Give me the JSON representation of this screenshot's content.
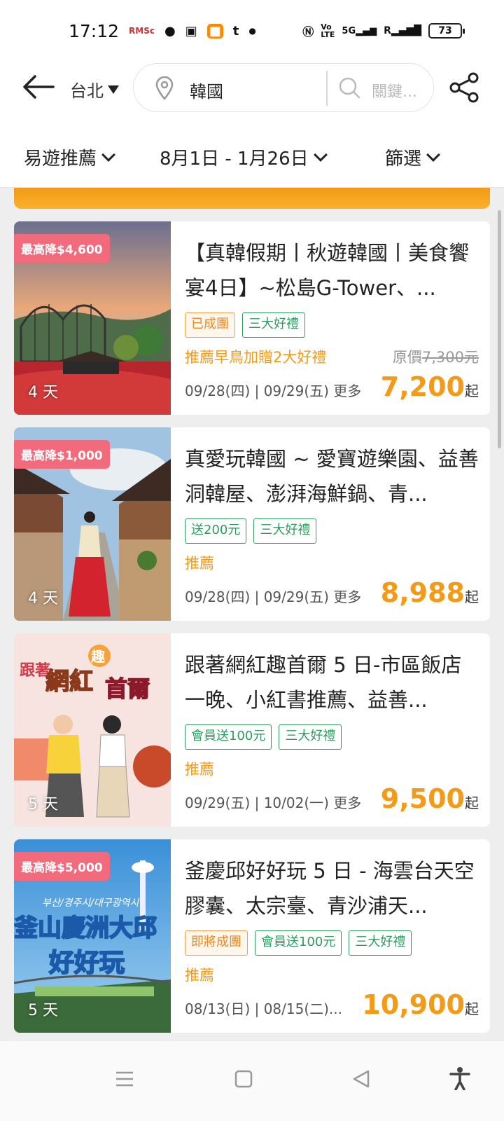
{
  "status": {
    "time": "17:12",
    "battery": "73",
    "notif_labels": [
      "RMSc",
      "t"
    ]
  },
  "header": {
    "city": "台北",
    "destination": "韓國",
    "keyword_placeholder": "關鍵..."
  },
  "filters": {
    "sort": "易遊推薦",
    "dates": "8月1日 - 1月26日",
    "filter": "篩選"
  },
  "cards": [
    {
      "discount": "最高降$4,600",
      "days": "4 天",
      "title": "【真韓假期丨秋遊韓國丨美食饗宴4日】~松島G-Tower、...",
      "tags": [
        {
          "label": "已成團",
          "style": "orange"
        },
        {
          "label": "三大好禮",
          "style": "green"
        }
      ],
      "promo": "推薦早鳥加贈2大好禮",
      "orig_label": "原價",
      "orig_price": "7,300元",
      "dates": "09/28(四) | 09/29(五) 更多",
      "price": "7,200",
      "suffix": "起"
    },
    {
      "discount": "最高降$1,000",
      "days": "4 天",
      "title": "真愛玩韓國 ~ 愛寶遊樂園、益善洞韓屋、澎湃海鮮鍋、青...",
      "tags": [
        {
          "label": "送200元",
          "style": "green"
        },
        {
          "label": "三大好禮",
          "style": "green"
        }
      ],
      "promo": "推薦",
      "orig_label": "",
      "orig_price": "",
      "dates": "09/28(四) | 09/29(五) 更多",
      "price": "8,988",
      "suffix": "起"
    },
    {
      "discount": "",
      "days": "5 天",
      "title": "跟著網紅趣首爾 5 日-市區飯店一晚、小紅書推薦、益善...",
      "tags": [
        {
          "label": "會員送100元",
          "style": "green"
        },
        {
          "label": "三大好禮",
          "style": "green"
        }
      ],
      "promo": "推薦",
      "orig_label": "",
      "orig_price": "",
      "dates": "09/29(五) | 10/02(一) 更多",
      "price": "9,500",
      "suffix": "起",
      "thumb_text": [
        "跟著",
        "網紅",
        "首爾",
        "趣"
      ]
    },
    {
      "discount": "最高降$5,000",
      "days": "5 天",
      "title": "釜慶邱好好玩 5 日 - 海雲台天空膠囊、太宗臺、青沙浦天...",
      "tags": [
        {
          "label": "即將成團",
          "style": "orange"
        },
        {
          "label": "會員送100元",
          "style": "green"
        },
        {
          "label": "三大好禮",
          "style": "green"
        }
      ],
      "promo": "推薦",
      "orig_label": "",
      "orig_price": "",
      "dates": "08/13(日) | 08/15(二)...",
      "price": "10,900",
      "suffix": "起",
      "thumb_text": [
        "부산/경주시/대구광역시",
        "釜山慶洲大邱",
        "好好玩"
      ]
    }
  ]
}
